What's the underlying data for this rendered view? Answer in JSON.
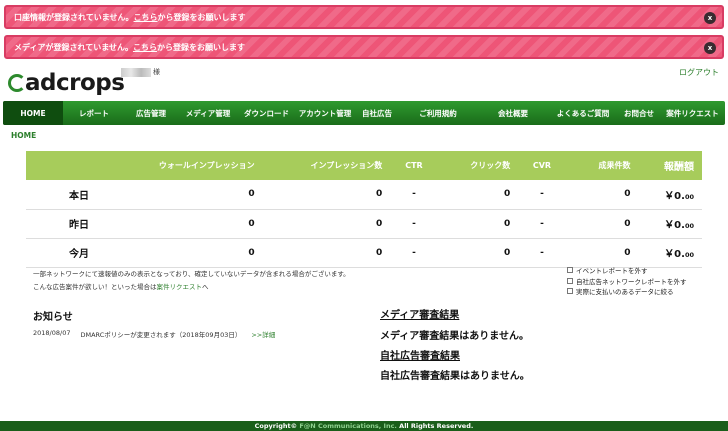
{
  "alerts": [
    {
      "text": "口座情報が登録されていません。",
      "link": "こちら",
      "tail": "から登録をお願いします",
      "close": "x"
    },
    {
      "text": "メディアが登録されていません。",
      "link": "こちら",
      "tail": "から登録をお願いします",
      "close": "x"
    }
  ],
  "header": {
    "logo": "adcrops",
    "user_suffix": "様",
    "logout": "ログアウト"
  },
  "nav": {
    "items": [
      {
        "label": "HOME",
        "active": true
      },
      {
        "label": "レポート"
      },
      {
        "label": "広告管理"
      },
      {
        "label": "メディア管理"
      },
      {
        "label": "ダウンロード"
      },
      {
        "label": "アカウント管理"
      },
      {
        "label": "自社広告"
      },
      {
        "label": "ご利用規約"
      },
      {
        "label": "会社概要"
      },
      {
        "label": "よくあるご質問"
      },
      {
        "label": "お問合せ"
      },
      {
        "label": "案件リクエスト"
      }
    ]
  },
  "breadcrumb": "HOME",
  "stats": {
    "columns": [
      "",
      "ウォールインプレッション",
      "インプレッション数",
      "CTR",
      "クリック数",
      "CVR",
      "成果件数",
      "報酬額"
    ],
    "rows": [
      {
        "label": "本日",
        "wall": "0",
        "imp": "0",
        "ctr": "-",
        "click": "0",
        "cvr": "-",
        "cv": "0",
        "reward": "￥0.",
        "reward_dec": "00"
      },
      {
        "label": "昨日",
        "wall": "0",
        "imp": "0",
        "ctr": "-",
        "click": "0",
        "cvr": "-",
        "cv": "0",
        "reward": "￥0.",
        "reward_dec": "00"
      },
      {
        "label": "今月",
        "wall": "0",
        "imp": "0",
        "ctr": "-",
        "click": "0",
        "cvr": "-",
        "cv": "0",
        "reward": "￥0.",
        "reward_dec": "00"
      }
    ]
  },
  "notes": {
    "line1": "一部ネットワークにて速報値のみの表示となっており、確定していないデータが含まれる場合がございます。",
    "line2_pre": "こんな広告案件が欲しい！といった場合は",
    "line2_link": "案件リクエスト",
    "line2_post": "へ"
  },
  "filters": [
    "イベントレポートを外す",
    "自社広告ネットワークレポートを外す",
    "実際に支払いのあるデータに絞る"
  ],
  "news": {
    "title": "お知らせ",
    "items": [
      {
        "date": "2018/08/07",
        "text": "DMARCポリシーが変更されます（2018年09月03日）",
        "more": ">>詳細"
      }
    ]
  },
  "reviews": {
    "media_heading": "メディア審査結果",
    "media_text": "メディア審査結果はありません。",
    "ad_heading": "自社広告審査結果",
    "ad_text": "自社広告審査結果はありません。"
  },
  "footer": {
    "pre": "Copyright© ",
    "company": "F@N Communications, Inc.",
    "post": " All Rights Reserved."
  }
}
